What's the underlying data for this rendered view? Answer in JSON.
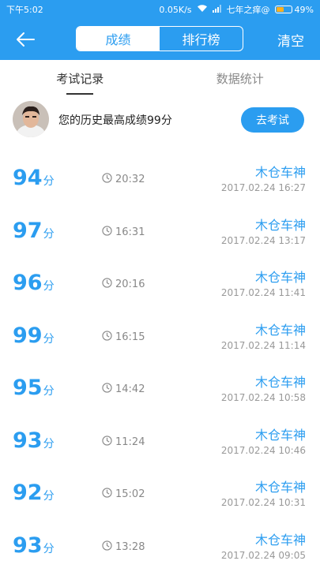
{
  "status_bar": {
    "time": "下午5:02",
    "network_speed": "0.05K/s",
    "carrier": "七年之痒@",
    "battery_percent": "49%",
    "battery_level": 0.49,
    "icons": [
      "wifi-icon",
      "signal-icon",
      "battery-icon"
    ]
  },
  "nav": {
    "back_icon": "back-arrow-icon",
    "segments": [
      "成绩",
      "排行榜"
    ],
    "active_segment": 0,
    "clear_label": "清空"
  },
  "tabs": {
    "items": [
      "考试记录",
      "数据统计"
    ],
    "active": 0
  },
  "banner": {
    "text": "您的历史最高成绩99分",
    "button_label": "去考试",
    "avatar_icon": "user-avatar"
  },
  "records": [
    {
      "score": "94",
      "unit": "分",
      "duration": "20:32",
      "name": "木仓车神",
      "date": "2017.02.24  16:27"
    },
    {
      "score": "97",
      "unit": "分",
      "duration": "16:31",
      "name": "木仓车神",
      "date": "2017.02.24  13:17"
    },
    {
      "score": "96",
      "unit": "分",
      "duration": "20:16",
      "name": "木仓车神",
      "date": "2017.02.24  11:41"
    },
    {
      "score": "99",
      "unit": "分",
      "duration": "16:15",
      "name": "木仓车神",
      "date": "2017.02.24  11:14"
    },
    {
      "score": "95",
      "unit": "分",
      "duration": "14:42",
      "name": "木仓车神",
      "date": "2017.02.24  10:58"
    },
    {
      "score": "93",
      "unit": "分",
      "duration": "11:24",
      "name": "木仓车神",
      "date": "2017.02.24  10:46"
    },
    {
      "score": "92",
      "unit": "分",
      "duration": "15:02",
      "name": "木仓车神",
      "date": "2017.02.24  10:31"
    },
    {
      "score": "93",
      "unit": "分",
      "duration": "13:28",
      "name": "木仓车神",
      "date": "2017.02.24  09:05"
    }
  ],
  "colors": {
    "accent": "#2b9df0",
    "text_primary": "#222222",
    "text_muted": "#999999"
  }
}
